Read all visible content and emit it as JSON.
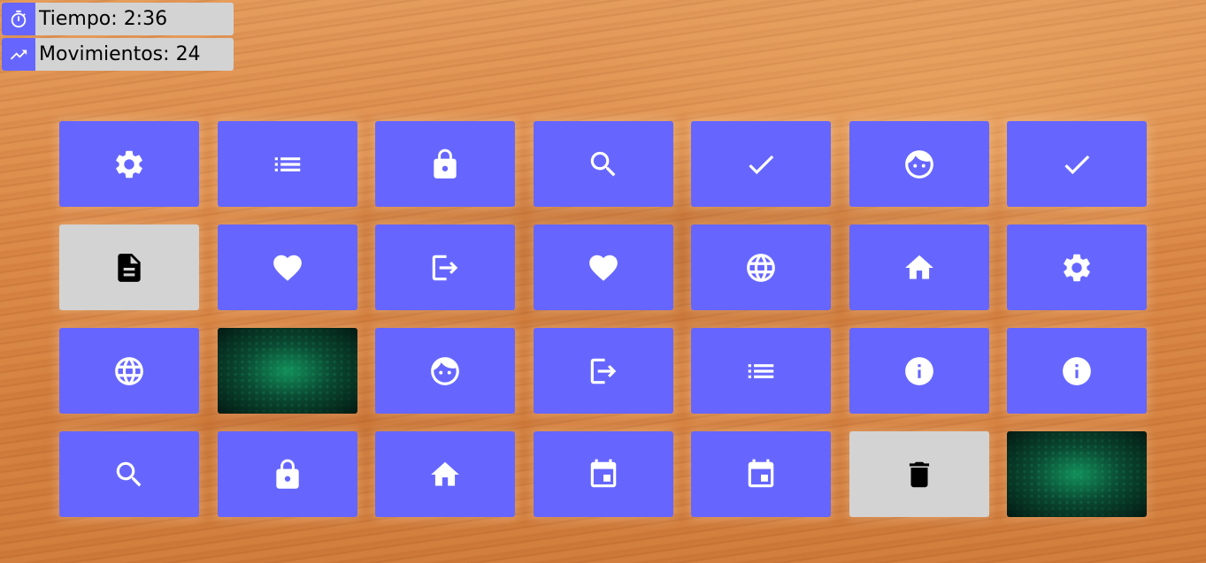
{
  "hud": {
    "time_label": "Tiempo:",
    "time_value": "2:36",
    "moves_label": "Movimientos:",
    "moves_value": "24",
    "time_icon": "timer-icon",
    "moves_icon": "trending-up-icon"
  },
  "colors": {
    "card_back": "#6666ff",
    "card_revealed": "#d3d3d3",
    "card_matched": "#0a2f22",
    "hud_background": "#d3d3d3"
  },
  "board": {
    "columns": 7,
    "rows": 4,
    "cards": [
      {
        "icon": "gear",
        "state": "hidden"
      },
      {
        "icon": "list",
        "state": "hidden"
      },
      {
        "icon": "lock",
        "state": "hidden"
      },
      {
        "icon": "search",
        "state": "hidden"
      },
      {
        "icon": "check",
        "state": "hidden"
      },
      {
        "icon": "face",
        "state": "hidden"
      },
      {
        "icon": "check",
        "state": "hidden"
      },
      {
        "icon": "document",
        "state": "revealed"
      },
      {
        "icon": "heart",
        "state": "hidden"
      },
      {
        "icon": "logout",
        "state": "hidden"
      },
      {
        "icon": "heart",
        "state": "hidden"
      },
      {
        "icon": "globe",
        "state": "hidden"
      },
      {
        "icon": "home",
        "state": "hidden"
      },
      {
        "icon": "gear",
        "state": "hidden"
      },
      {
        "icon": "globe",
        "state": "hidden"
      },
      {
        "icon": "",
        "state": "matched"
      },
      {
        "icon": "face",
        "state": "hidden"
      },
      {
        "icon": "logout",
        "state": "hidden"
      },
      {
        "icon": "list",
        "state": "hidden"
      },
      {
        "icon": "info",
        "state": "hidden"
      },
      {
        "icon": "info",
        "state": "hidden"
      },
      {
        "icon": "search",
        "state": "hidden"
      },
      {
        "icon": "lock",
        "state": "hidden"
      },
      {
        "icon": "home",
        "state": "hidden"
      },
      {
        "icon": "calendar",
        "state": "hidden"
      },
      {
        "icon": "calendar",
        "state": "hidden"
      },
      {
        "icon": "trash",
        "state": "revealed"
      },
      {
        "icon": "",
        "state": "matched"
      }
    ]
  }
}
